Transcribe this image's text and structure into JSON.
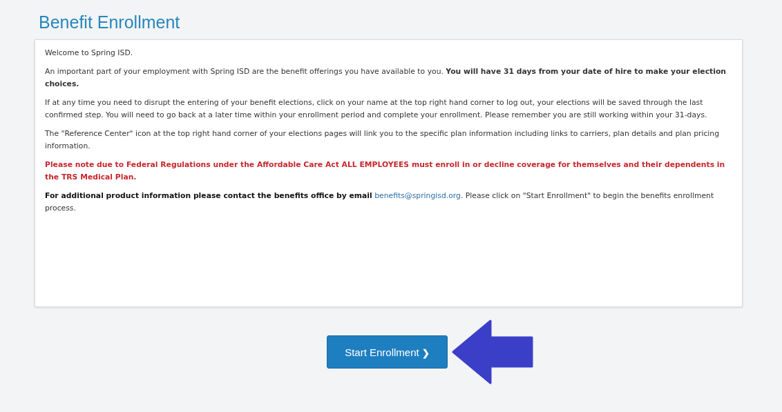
{
  "title": "Benefit Enrollment",
  "paragraphs": [
    {
      "kind": "plain",
      "text": "Welcome to Spring ISD."
    },
    {
      "kind": "highlight",
      "text": "An important part of your employment with Spring ISD are the benefit offerings you have available to you. **You will have 31 days from your date of hire to make your election choices.**"
    },
    {
      "kind": "plain",
      "text": "If at any time you need to disrupt the entering of your benefit elections, click on your name at the top right hand corner to log out, your elections will be saved through the last confirmed step. You will need to go back at a later time within your enrollment period and complete your enrollment. Please remember you are still working within your 31-days."
    },
    {
      "kind": "plain",
      "text": "The \"Reference Center\" icon at the top right hand corner of your elections pages will link you to the specific plan information including links to carriers, plan details and plan pricing information."
    },
    {
      "kind": "notice",
      "text": "Please note due to Federal Regulations under the Affordable Care Act ALL EMPLOYEES must enroll in or decline coverage for themselves and their dependents in the TRS Medical Plan."
    }
  ],
  "contact": {
    "lead": "For additional product information please contact the benefits office by email",
    "email": "benefits@springisd.org",
    "rest": ". Please click on \"Start Enrollment\" to begin the benefits enrollment process."
  },
  "button": {
    "label": "Start Enrollment",
    "caret": "❯"
  }
}
